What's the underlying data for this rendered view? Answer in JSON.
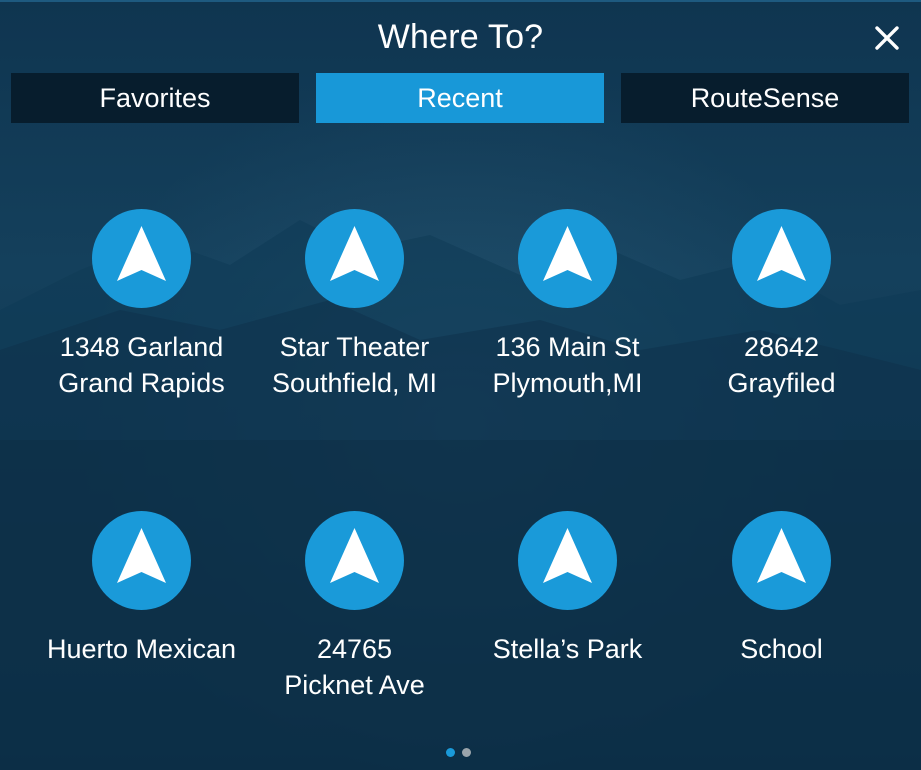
{
  "header": {
    "title": "Where To?",
    "close_icon": "close-icon"
  },
  "tabs": [
    {
      "label": "Favorites",
      "active": false
    },
    {
      "label": "Recent",
      "active": true
    },
    {
      "label": "RouteSense",
      "active": false
    }
  ],
  "destinations": [
    {
      "line1": "1348 Garland",
      "line2": "Grand Rapids",
      "icon": "navigation-arrow-icon"
    },
    {
      "line1": "Star Theater",
      "line2": "Southfield, MI",
      "icon": "navigation-arrow-icon"
    },
    {
      "line1": "136 Main St",
      "line2": "Plymouth,MI",
      "icon": "navigation-arrow-icon"
    },
    {
      "line1": "28642",
      "line2": "Grayfiled",
      "icon": "navigation-arrow-icon"
    },
    {
      "line1": "Huerto Mexican",
      "line2": "",
      "icon": "navigation-arrow-icon"
    },
    {
      "line1": "24765",
      "line2": "Picknet Ave",
      "icon": "navigation-arrow-icon"
    },
    {
      "line1": "Stella’s Park",
      "line2": "",
      "icon": "navigation-arrow-icon"
    },
    {
      "line1": "School",
      "line2": "",
      "icon": "navigation-arrow-icon"
    }
  ],
  "pagination": {
    "current_page": 1,
    "total_pages": 2
  },
  "colors": {
    "accent": "#1898d8",
    "icon_circle": "#1a9ad9",
    "tab_inactive": "#071d2d",
    "dot_active": "#1a9ad9",
    "dot_inactive": "#9aa4ab"
  }
}
